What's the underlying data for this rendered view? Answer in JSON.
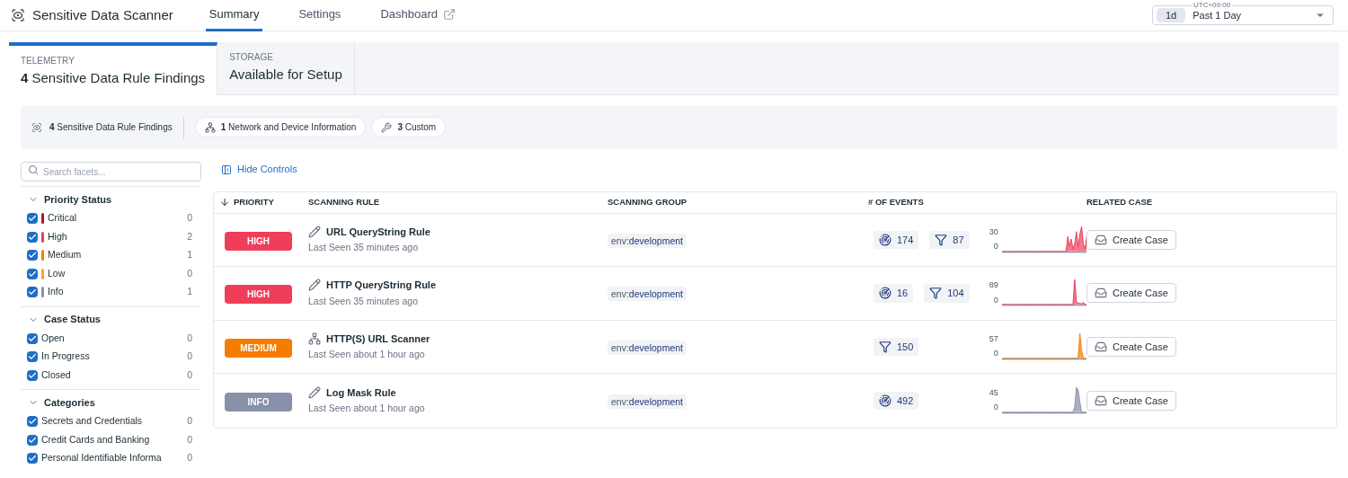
{
  "app": {
    "title": "Sensitive Data Scanner"
  },
  "nav_tabs": [
    {
      "label": "Summary",
      "selected": true,
      "external": false
    },
    {
      "label": "Settings",
      "selected": false,
      "external": false
    },
    {
      "label": "Dashboard",
      "selected": false,
      "external": true
    }
  ],
  "time_picker": {
    "timezone": "UTC+09:00",
    "badge": "1d",
    "value": "Past 1 Day"
  },
  "source_tabs": [
    {
      "label": "TELEMETRY",
      "count": "4",
      "title": "Sensitive Data Rule Findings",
      "selected": true
    },
    {
      "label": "STORAGE",
      "title": "Available for Setup",
      "selected": false
    }
  ],
  "summary": {
    "total": {
      "count": "4",
      "label": "Sensitive Data Rule Findings"
    },
    "chips": [
      {
        "kind": "network",
        "count": "1",
        "label": "Network and Device Information"
      },
      {
        "kind": "custom",
        "count": "3",
        "label": "Custom"
      }
    ]
  },
  "facets": {
    "search_placeholder": "Search facets...",
    "groups": [
      {
        "title": "Priority Status",
        "expanded": true,
        "items": [
          {
            "label": "Critical",
            "count": "0",
            "checked": true,
            "color": "#a8182b"
          },
          {
            "label": "High",
            "count": "2",
            "checked": true,
            "color": "#ee3e59"
          },
          {
            "label": "Medium",
            "count": "1",
            "checked": true,
            "color": "#f57c00"
          },
          {
            "label": "Low",
            "count": "0",
            "checked": true,
            "color": "#e6a93d"
          },
          {
            "label": "Info",
            "count": "1",
            "checked": true,
            "color": "#8890aa"
          }
        ]
      },
      {
        "title": "Case Status",
        "expanded": true,
        "items": [
          {
            "label": "Open",
            "count": "0",
            "checked": true
          },
          {
            "label": "In Progress",
            "count": "0",
            "checked": true
          },
          {
            "label": "Closed",
            "count": "0",
            "checked": true
          }
        ]
      },
      {
        "title": "Categories",
        "expanded": true,
        "items": [
          {
            "label": "Secrets and Credentials",
            "count": "0",
            "checked": true
          },
          {
            "label": "Credit Cards and Banking",
            "count": "0",
            "checked": true
          },
          {
            "label": "Personal Identifiable Informa",
            "count": "0",
            "checked": true
          }
        ]
      }
    ]
  },
  "hide_controls": "Hide Controls",
  "table": {
    "columns": [
      "PRIORITY",
      "SCANNING RULE",
      "SCANNING GROUP",
      "# OF EVENTS",
      "RELATED CASE"
    ],
    "rows": [
      {
        "priority": "HIGH",
        "color": "#ee3e59",
        "kind": "custom",
        "rule": "URL QueryString Rule",
        "last_seen": "Last Seen 35 minutes ago",
        "group_key": "env:",
        "group_value": "development",
        "events": [
          {
            "kind": "samples",
            "count": "174"
          },
          {
            "kind": "matches",
            "count": "87"
          }
        ],
        "axis_max": "30",
        "axis_min": "0",
        "action": "Create Case"
      },
      {
        "priority": "HIGH",
        "color": "#ee3e59",
        "kind": "custom",
        "rule": "HTTP QueryString Rule",
        "last_seen": "Last Seen 35 minutes ago",
        "group_key": "env:",
        "group_value": "development",
        "events": [
          {
            "kind": "samples",
            "count": "16"
          },
          {
            "kind": "matches",
            "count": "104"
          }
        ],
        "axis_max": "89",
        "axis_min": "0",
        "action": "Create Case"
      },
      {
        "priority": "MEDIUM",
        "color": "#f57c00",
        "kind": "network",
        "rule": "HTTP(S) URL Scanner",
        "last_seen": "Last Seen about 1 hour ago",
        "group_key": "env:",
        "group_value": "development",
        "events": [
          {
            "kind": "matches",
            "count": "150"
          }
        ],
        "axis_max": "57",
        "axis_min": "0",
        "action": "Create Case"
      },
      {
        "priority": "INFO",
        "color": "#8890aa",
        "kind": "custom",
        "rule": "Log Mask Rule",
        "last_seen": "Last Seen about 1 hour ago",
        "group_key": "env:",
        "group_value": "development",
        "events": [
          {
            "kind": "samples",
            "count": "492"
          }
        ],
        "axis_max": "45",
        "axis_min": "0",
        "action": "Create Case"
      }
    ]
  }
}
